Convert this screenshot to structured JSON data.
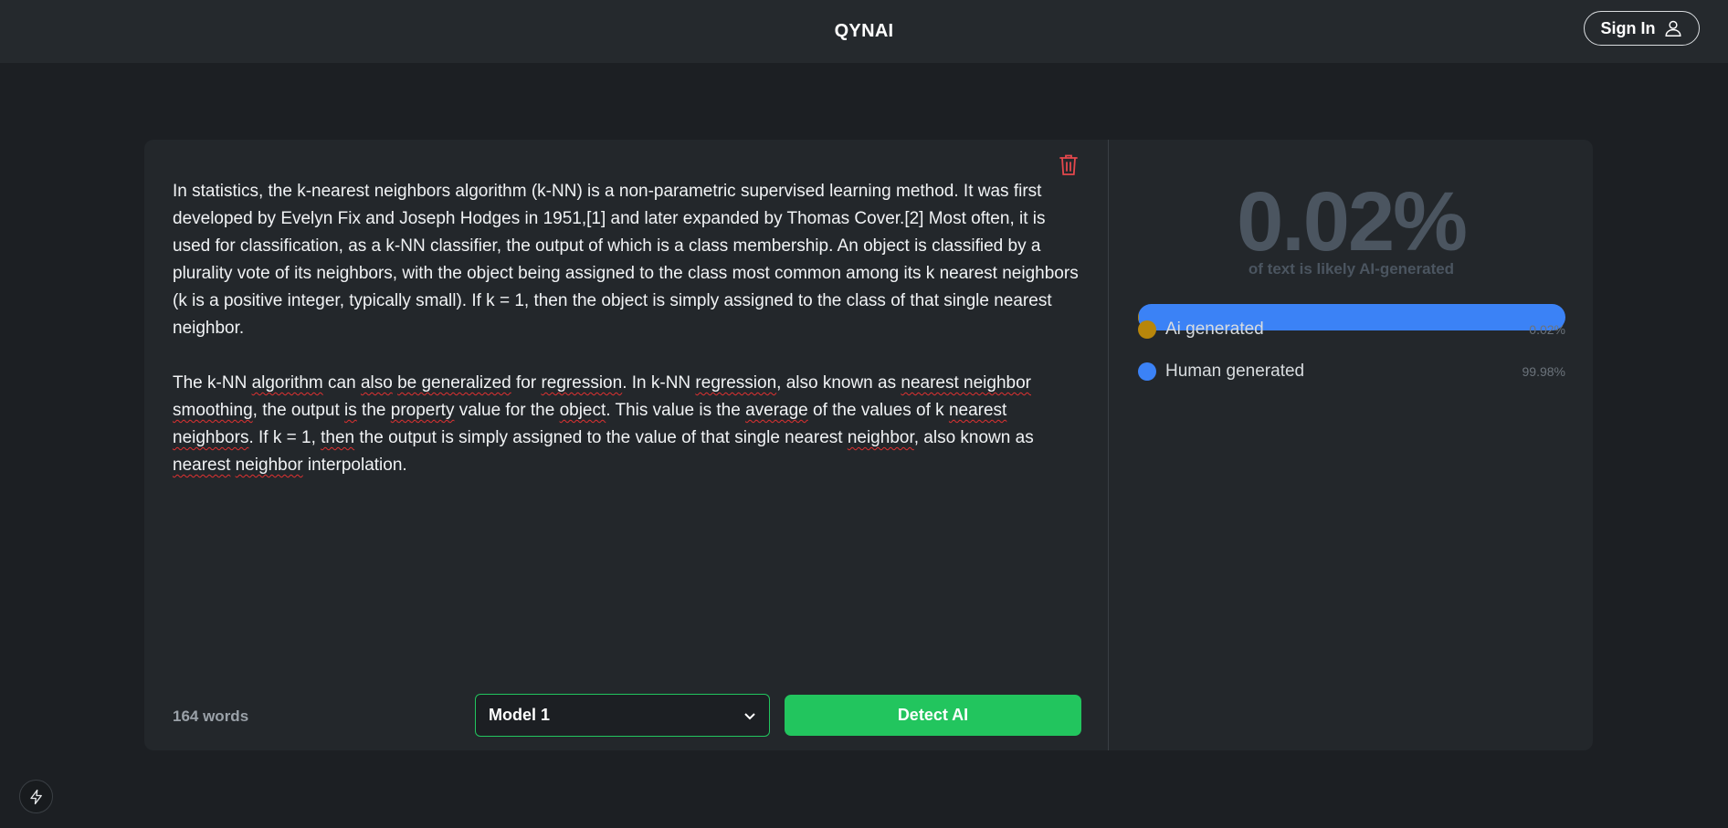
{
  "header": {
    "brand": "QYNAI",
    "signin_label": "Sign In",
    "signin_icon": "user-icon"
  },
  "editor": {
    "paragraphs": [
      [
        {
          "t": "In statistics, the k-nearest neighbors algorithm (k-NN) is a non-parametric supervised learning method. It was first developed by Evelyn Fix and Joseph Hodges in 1951,[1] and later expanded by Thomas Cover.[2] Most often, it is used for classification, as a k-NN classifier, the output of which is a class membership. An object is classified by a plurality vote of its neighbors, with the object being assigned to the class most common among its k nearest neighbors (k is a positive integer, typically small). If k = 1, then the object is simply assigned to the class of that single nearest neighbor.",
          "sq": false
        }
      ],
      [
        {
          "t": "The k-NN ",
          "sq": false
        },
        {
          "t": "algorithm",
          "sq": true
        },
        {
          "t": " can ",
          "sq": false
        },
        {
          "t": "also",
          "sq": true
        },
        {
          "t": " ",
          "sq": false
        },
        {
          "t": "be generalized",
          "sq": true
        },
        {
          "t": " for ",
          "sq": false
        },
        {
          "t": "regression",
          "sq": true
        },
        {
          "t": ". In k-NN ",
          "sq": false
        },
        {
          "t": "regression",
          "sq": true
        },
        {
          "t": ", also known as ",
          "sq": false
        },
        {
          "t": "nearest neighbor",
          "sq": true
        },
        {
          "t": " ",
          "sq": false
        },
        {
          "t": "smoothing",
          "sq": true
        },
        {
          "t": ", the output ",
          "sq": false
        },
        {
          "t": "is",
          "sq": true
        },
        {
          "t": " the ",
          "sq": false
        },
        {
          "t": "property",
          "sq": true
        },
        {
          "t": " value for the ",
          "sq": false
        },
        {
          "t": "object",
          "sq": true
        },
        {
          "t": ". This value is the ",
          "sq": false
        },
        {
          "t": "average",
          "sq": true
        },
        {
          "t": " of the values of k ",
          "sq": false
        },
        {
          "t": "nearest",
          "sq": true
        },
        {
          "t": " ",
          "sq": false
        },
        {
          "t": "neighbors",
          "sq": true
        },
        {
          "t": ". If k = 1, ",
          "sq": false
        },
        {
          "t": "then",
          "sq": true
        },
        {
          "t": " the output is simply assigned to the value of that single nearest ",
          "sq": false
        },
        {
          "t": "neighbor",
          "sq": true
        },
        {
          "t": ", also known as ",
          "sq": false
        },
        {
          "t": "nearest",
          "sq": true
        },
        {
          "t": " ",
          "sq": false
        },
        {
          "t": "neighbor",
          "sq": true
        },
        {
          "t": " interpolation.",
          "sq": false
        }
      ]
    ],
    "word_count": "164 words",
    "model_selected": "Model 1",
    "detect_label": "Detect AI",
    "trash_icon": "trash-icon"
  },
  "results": {
    "percentage": "0.02%",
    "caption": "of text is likely AI-generated",
    "ai_fraction": 0.0002,
    "legend": [
      {
        "label": "Ai generated",
        "value": "0.02%",
        "color": "#b8860b"
      },
      {
        "label": "Human generated",
        "value": "99.98%",
        "color": "#3b82f6"
      }
    ]
  },
  "footer": {
    "bolt_icon": "lightning-icon"
  }
}
